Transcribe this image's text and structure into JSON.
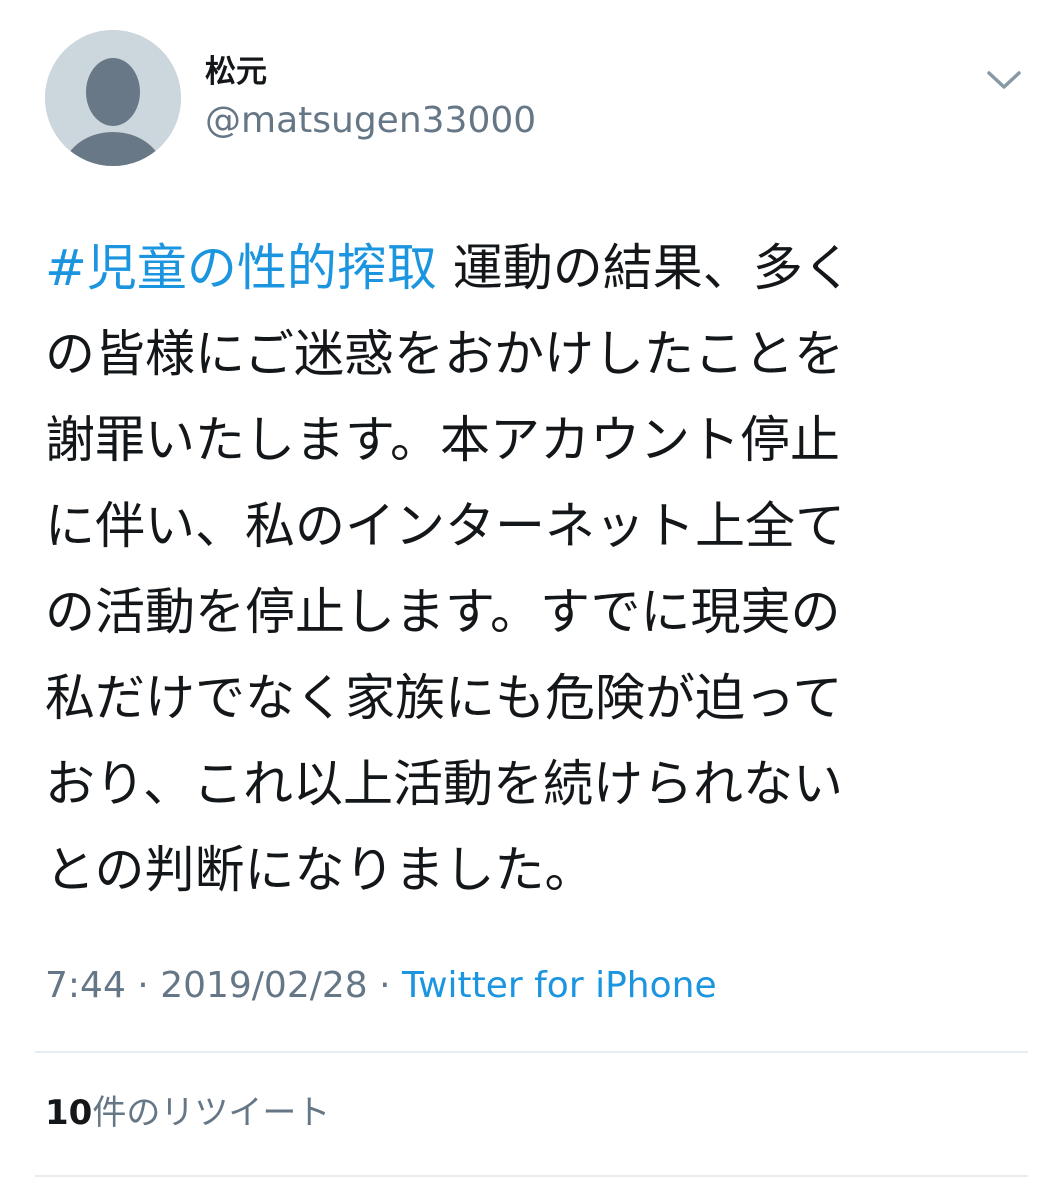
{
  "user": {
    "display_name": "松元",
    "handle": "@matsugen33000",
    "avatar_icon": "default-avatar-icon"
  },
  "menu": {
    "icon": "chevron-down-icon"
  },
  "tweet": {
    "hashtag": "#児童の性的搾取",
    "lines": [
      " 運動の結果、多く",
      "の皆様にご迷惑をおかけしたことを",
      "謝罪いたします。本アカウント停止",
      "に伴い、私のインターネット上全て",
      "の活動を停止します。すでに現実の",
      "私だけでなく家族にも危険が迫って",
      "おり、これ以上活動を続けられない",
      "との判断になりました。"
    ]
  },
  "meta": {
    "time": "7:44",
    "separator": " · ",
    "date": "2019/02/28",
    "source": "Twitter for iPhone"
  },
  "stats": {
    "retweet_count": "10",
    "retweet_label": "件のリツイート"
  },
  "colors": {
    "link": "#1b95e0",
    "secondary_text": "#657786",
    "primary_text": "#14171a",
    "divider": "#e6ecf0",
    "avatar_bg": "#ccd6dd",
    "avatar_fg": "#697887"
  }
}
